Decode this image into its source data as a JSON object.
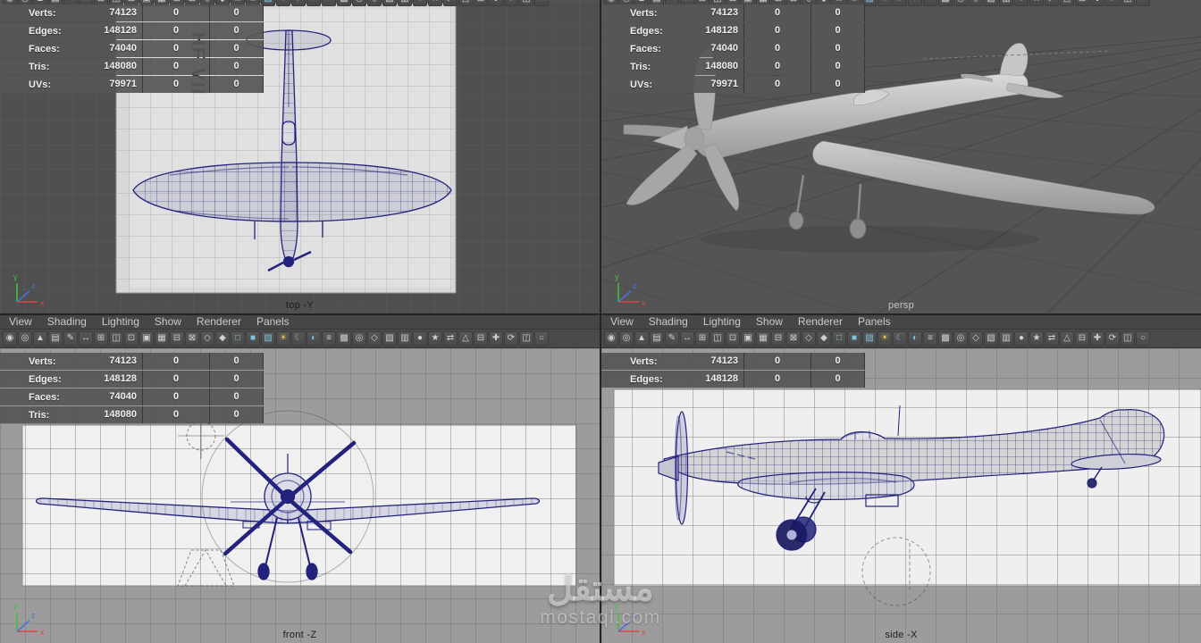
{
  "colors": {
    "wireframe": "#23237e",
    "accent_cool": "#7fc4dd",
    "accent_warm": "#e8c35a",
    "blueprint_paper": "#d8d8d8",
    "paper": "#f0f0f0",
    "viewport_gray": "#505050",
    "menu_bg": "#464646",
    "hud_row_bg": "#565656"
  },
  "menus": [
    "View",
    "Shading",
    "Lighting",
    "Show",
    "Renderer",
    "Panels"
  ],
  "toolbar_icons": [
    {
      "name": "select-camera-icon",
      "glyph": "◉"
    },
    {
      "name": "lock-camera-icon",
      "glyph": "◎"
    },
    {
      "name": "camera-bookmark-icon",
      "glyph": "▲"
    },
    {
      "name": "image-plane-icon",
      "glyph": "▤"
    },
    {
      "name": "grease-pencil-icon",
      "glyph": "✎"
    },
    {
      "name": "pan-zoom-icon",
      "glyph": "↔"
    },
    {
      "name": "grid-toggle-icon",
      "glyph": "⊞"
    },
    {
      "name": "film-gate-icon",
      "glyph": "◫"
    },
    {
      "name": "resolution-gate-icon",
      "glyph": "⊡"
    },
    {
      "name": "gate-mask-icon",
      "glyph": "▣"
    },
    {
      "name": "field-chart-icon",
      "glyph": "▦"
    },
    {
      "name": "safe-action-icon",
      "glyph": "⊟"
    },
    {
      "name": "safe-title-icon",
      "glyph": "⊠"
    },
    {
      "name": "frame-all-icon",
      "glyph": "◇"
    },
    {
      "name": "frame-selection-icon",
      "glyph": "◆"
    },
    {
      "name": "wireframe-mode-icon",
      "glyph": "□",
      "color": "#7fc4dd"
    },
    {
      "name": "shaded-mode-icon",
      "glyph": "■",
      "color": "#7fc4dd"
    },
    {
      "name": "textured-mode-icon",
      "glyph": "▨",
      "color": "#7fc4dd"
    },
    {
      "name": "use-all-lights-icon",
      "glyph": "☀",
      "color": "#e8c35a"
    },
    {
      "name": "shadows-icon",
      "glyph": "☾",
      "color": "#8fa3c9"
    },
    {
      "name": "occlusion-icon",
      "glyph": "◐",
      "color": "#7fc4dd"
    },
    {
      "name": "motion-blur-icon",
      "glyph": "≡"
    },
    {
      "name": "multisample-icon",
      "glyph": "▩"
    },
    {
      "name": "depth-of-field-icon",
      "glyph": "◎"
    },
    {
      "name": "isolate-select-icon",
      "glyph": "◇"
    },
    {
      "name": "xray-icon",
      "glyph": "▧"
    },
    {
      "name": "wireframe-on-shaded-icon",
      "glyph": "▥"
    },
    {
      "name": "default-material-icon",
      "glyph": "●"
    },
    {
      "name": "paint-effects-icon",
      "glyph": "★"
    },
    {
      "name": "stereo-icon",
      "glyph": "⇄"
    },
    {
      "name": "ortho-toggle-icon",
      "glyph": "△"
    },
    {
      "name": "hud-toggle-icon",
      "glyph": "⊟"
    },
    {
      "name": "axis-toggle-icon",
      "glyph": "✚"
    },
    {
      "name": "refresh-icon",
      "glyph": "⟳"
    },
    {
      "name": "panel-layout-icon",
      "glyph": "◫"
    },
    {
      "name": "sphere-primitive-icon",
      "glyph": "○"
    }
  ],
  "hud": {
    "top_left": [
      {
        "label": "Verts:",
        "value": "74123",
        "z1": "0",
        "z2": "0"
      },
      {
        "label": "Edges:",
        "value": "148128",
        "z1": "0",
        "z2": "0"
      },
      {
        "label": "Faces:",
        "value": "74040",
        "z1": "0",
        "z2": "0"
      },
      {
        "label": "Tris:",
        "value": "148080",
        "z1": "0",
        "z2": "0"
      },
      {
        "label": "UVs:",
        "value": "79971",
        "z1": "0",
        "z2": "0"
      }
    ],
    "top_right": [
      {
        "label": "Verts:",
        "value": "74123",
        "z1": "0",
        "z2": "0"
      },
      {
        "label": "Edges:",
        "value": "148128",
        "z1": "0",
        "z2": "0"
      },
      {
        "label": "Faces:",
        "value": "74040",
        "z1": "0",
        "z2": "0"
      },
      {
        "label": "Tris:",
        "value": "148080",
        "z1": "0",
        "z2": "0"
      },
      {
        "label": "UVs:",
        "value": "79971",
        "z1": "0",
        "z2": "0"
      }
    ],
    "bottom_left": [
      {
        "label": "Verts:",
        "value": "74123",
        "z1": "0",
        "z2": "0"
      },
      {
        "label": "Edges:",
        "value": "148128",
        "z1": "0",
        "z2": "0"
      },
      {
        "label": "Faces:",
        "value": "74040",
        "z1": "0",
        "z2": "0"
      },
      {
        "label": "Tris:",
        "value": "148080",
        "z1": "0",
        "z2": "0"
      }
    ],
    "bottom_right": [
      {
        "label": "Verts:",
        "value": "74123",
        "z1": "0",
        "z2": "0"
      },
      {
        "label": "Edges:",
        "value": "148128",
        "z1": "0",
        "z2": "0"
      }
    ]
  },
  "viewports": {
    "top_left": {
      "label": "top -Y",
      "blueprint_text": "HF VII"
    },
    "top_right": {
      "label": "persp"
    },
    "bottom_left": {
      "label": "front -Z"
    },
    "bottom_right": {
      "label": "side -X"
    }
  },
  "axis_gizmo": {
    "x": "x",
    "y": "y",
    "z": "z"
  },
  "watermark": {
    "title": "مستقل",
    "subtitle": "mostaql.com"
  }
}
